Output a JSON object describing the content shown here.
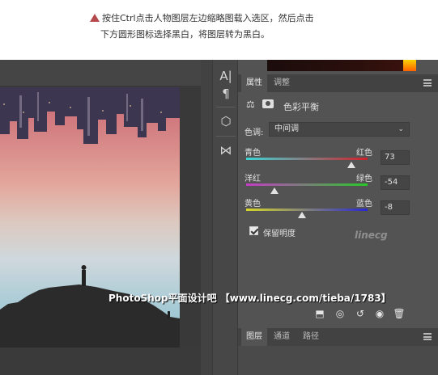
{
  "caption": {
    "line1": "按住Ctrl点击人物图层左边缩略图载入选区，然后点击",
    "line2": "下方圆形图标选择黑白，将图层转为黑白。"
  },
  "tools": [
    {
      "icon": "text-tool-icon",
      "glyph": "A|"
    },
    {
      "icon": "paragraph-icon",
      "glyph": "¶"
    },
    {
      "icon": "3d-cube-icon",
      "glyph": "⬡"
    },
    {
      "icon": "transform-icon",
      "glyph": "⋈"
    }
  ],
  "properties": {
    "tabs": [
      {
        "label": "属性",
        "active": true
      },
      {
        "label": "调整",
        "active": false
      }
    ],
    "title": "色彩平衡",
    "tone": {
      "label": "色调:",
      "value": "中间调"
    },
    "sliders": [
      {
        "left": "青色",
        "right": "红色",
        "value": "73",
        "ratio": 0.865,
        "colors": [
          "#3cd6d6",
          "#d0202a"
        ]
      },
      {
        "left": "洋红",
        "right": "绿色",
        "value": "-54",
        "ratio": 0.23,
        "colors": [
          "#c43cc4",
          "#28c828"
        ]
      },
      {
        "left": "黄色",
        "right": "蓝色",
        "value": "-8",
        "ratio": 0.46,
        "colors": [
          "#d6d628",
          "#2828d0"
        ]
      }
    ],
    "preserve_luminosity": {
      "label": "保留明度",
      "checked": true
    }
  },
  "layers": {
    "tabs": [
      {
        "label": "图层",
        "active": true
      },
      {
        "label": "通道",
        "active": false
      },
      {
        "label": "路径",
        "active": false
      }
    ]
  },
  "watermark": "PhotoShop平面设计吧 【www.linecg.com/tieba/1783】",
  "faint_watermark": "linecg"
}
